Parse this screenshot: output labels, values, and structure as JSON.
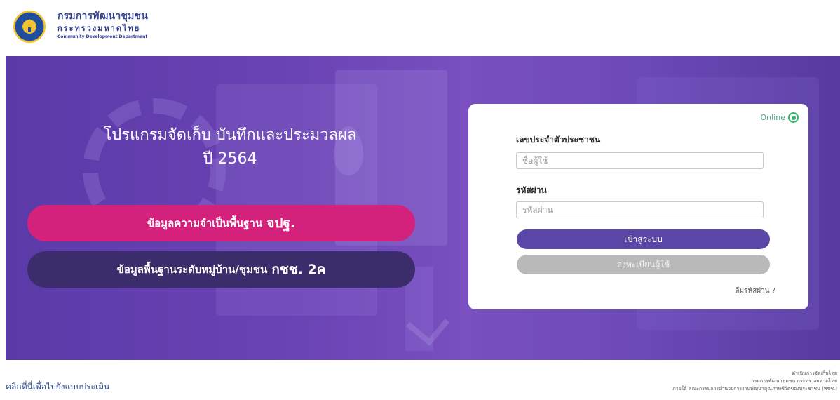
{
  "header": {
    "org_name_th": "กรมการพัฒนาชุมชน",
    "ministry_th": "กระทรวงมหาดไทย",
    "org_name_en": "Community Development Department"
  },
  "hero": {
    "title_line1": "โปรแกรมจัดเก็บ บันทึกและประมวลผล",
    "title_line2": "ปี 2564",
    "btn_jpt_prefix": "ข้อมูลความจำเป็นพื้นฐาน",
    "btn_jpt_code": "จปฐ.",
    "btn_kchch_prefix": "ข้อมูลพื้นฐานระดับหมู่บ้าน/ชุมชน",
    "btn_kchch_code": "กชช. 2ค"
  },
  "login": {
    "status_text": "Online",
    "user_label": "เลขประจำตัวประชาชน",
    "user_placeholder": "ชื่อผู้ใช้",
    "pass_label": "รหัสผ่าน",
    "pass_placeholder": "รหัสผ่าน",
    "login_button": "เข้าสู่ระบบ",
    "register_button": "ลงทะเบียนผู้ใช้",
    "forgot_link": "ลืมรหัสผ่าน ?"
  },
  "footer": {
    "eval_link": "คลิกที่นี่เพื่อไปยังแบบประเมิน",
    "credit_line1": "ดำเนินการจัดเก็บโดย",
    "credit_line2": "กรมการพัฒนาชุมชน กระทรวงมหาดไทย",
    "credit_line3": "ภายใต้ คณะกรรมการอำนวยการงานพัฒนาคุณภาพชีวิตของประชาชน (พชช.)"
  },
  "colors": {
    "hero_purple": "#6a43b4",
    "jpt_pink": "#d4227c",
    "kchch_navy": "#3b2d6b",
    "login_purple": "#5a46a6",
    "register_gray": "#b9b9b9",
    "online_green": "#32b36a"
  }
}
